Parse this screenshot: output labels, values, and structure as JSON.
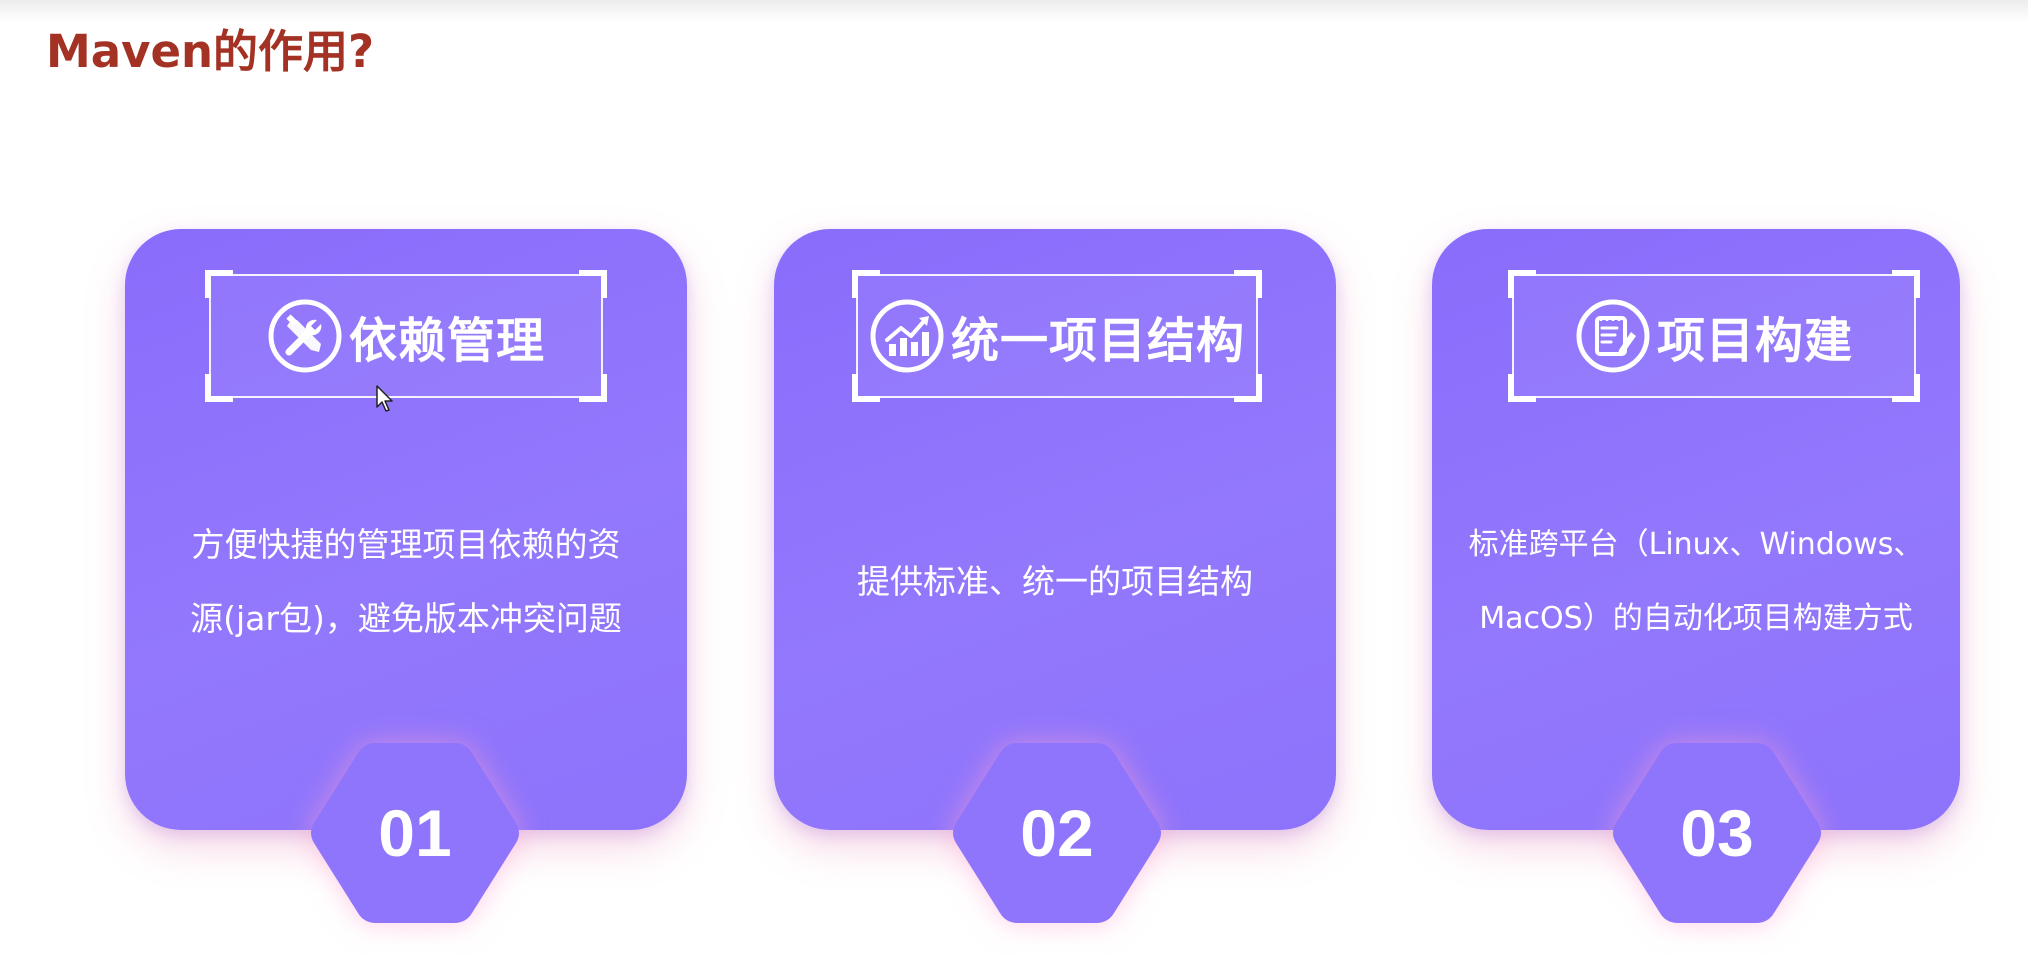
{
  "page": {
    "title": "Maven的作用?"
  },
  "colors": {
    "title": "#a33224",
    "card": "#8f74fc",
    "text": "#ffffff"
  },
  "cards": [
    {
      "icon": "tools-icon",
      "heading": "依赖管理",
      "description_lines": [
        "方便快捷的管理项目依赖的资",
        "源(jar包)，避免版本冲突问题"
      ],
      "number": "01"
    },
    {
      "icon": "growth-chart-icon",
      "heading": "统一项目结构",
      "description_lines": [
        "提供标准、统一的项目结构"
      ],
      "number": "02"
    },
    {
      "icon": "document-edit-icon",
      "heading": "项目构建",
      "description_lines": [
        "标准跨平台（Linux、Windows、",
        "MacOS）的自动化项目构建方式"
      ],
      "number": "03"
    }
  ]
}
